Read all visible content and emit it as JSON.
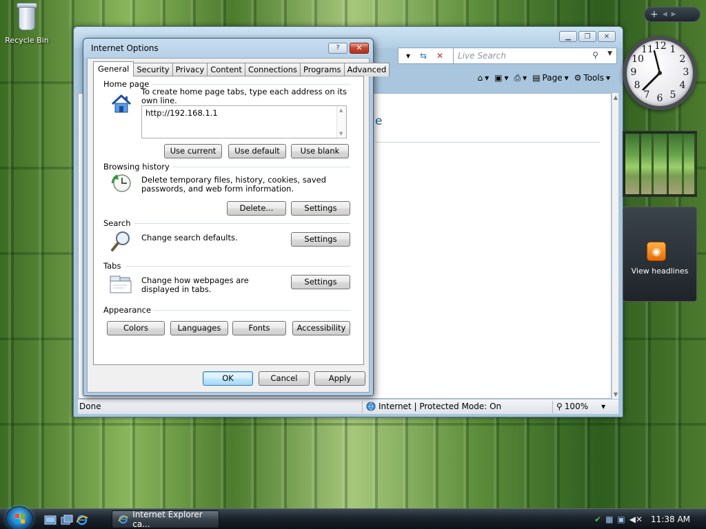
{
  "desktop": {
    "recycle_bin_label": "Recycle Bin"
  },
  "ie_window": {
    "search_placeholder": "Live Search",
    "cmd_page": "Page",
    "cmd_tools": "Tools",
    "content_fragment": "e",
    "status_done": "Done",
    "status_zone": "Internet | Protected Mode: On",
    "status_zoom": "100%"
  },
  "gadgets": {
    "clock_numbers": [
      "12",
      "1",
      "2",
      "3",
      "4",
      "5",
      "6",
      "7",
      "8",
      "9",
      "10",
      "11"
    ],
    "feeds_label": "View headlines"
  },
  "dialog": {
    "title": "Internet Options",
    "help_button": "?",
    "tabs": [
      {
        "label": "General",
        "active": true
      },
      {
        "label": "Security",
        "active": false
      },
      {
        "label": "Privacy",
        "active": false
      },
      {
        "label": "Content",
        "active": false
      },
      {
        "label": "Connections",
        "active": false
      },
      {
        "label": "Programs",
        "active": false
      },
      {
        "label": "Advanced",
        "active": false
      }
    ],
    "home_page": {
      "label": "Home page",
      "description": "To create home page tabs, type each address on its own line.",
      "value": "http://192.168.1.1",
      "use_current": "Use current",
      "use_default": "Use default",
      "use_blank": "Use blank"
    },
    "browsing_history": {
      "label": "Browsing history",
      "description": "Delete temporary files, history, cookies, saved passwords, and web form information.",
      "delete_button": "Delete...",
      "settings_button": "Settings"
    },
    "search": {
      "label": "Search",
      "description": "Change search defaults.",
      "settings_button": "Settings"
    },
    "tabs_section": {
      "label": "Tabs",
      "description": "Change how webpages are displayed in tabs.",
      "settings_button": "Settings"
    },
    "appearance": {
      "label": "Appearance",
      "colors": "Colors",
      "languages": "Languages",
      "fonts": "Fonts",
      "accessibility": "Accessibility"
    },
    "ok": "OK",
    "cancel": "Cancel",
    "apply": "Apply"
  },
  "taskbar": {
    "task_ie_label": "Internet Explorer ca...",
    "clock_time": "11:38 AM"
  }
}
